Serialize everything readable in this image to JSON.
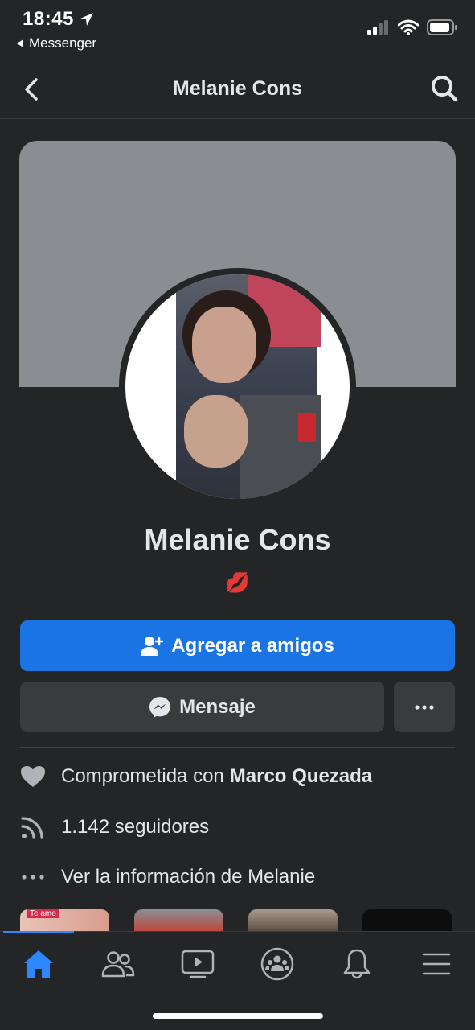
{
  "status_bar": {
    "time": "18:45",
    "back_app": "Messenger"
  },
  "nav": {
    "title": "Melanie Cons"
  },
  "profile": {
    "name": "Melanie Cons",
    "bio": "💋"
  },
  "actions": {
    "add_friend_label": "Agregar a amigos",
    "message_label": "Mensaje"
  },
  "details": {
    "relationship_prefix": "Comprometida con",
    "relationship_partner": "Marco Quezada",
    "followers": "1.142 seguidores",
    "see_info": "Ver la información de Melanie"
  },
  "photos": {
    "first_caption": "Te amo"
  },
  "colors": {
    "accent": "#1b74e4",
    "background": "#242526",
    "surface": "#3a3b3c"
  },
  "tabs": [
    {
      "icon": "home-icon",
      "active": true
    },
    {
      "icon": "friends-icon",
      "active": false
    },
    {
      "icon": "watch-icon",
      "active": false
    },
    {
      "icon": "groups-icon",
      "active": false
    },
    {
      "icon": "bell-icon",
      "active": false
    },
    {
      "icon": "menu-icon",
      "active": false
    }
  ]
}
